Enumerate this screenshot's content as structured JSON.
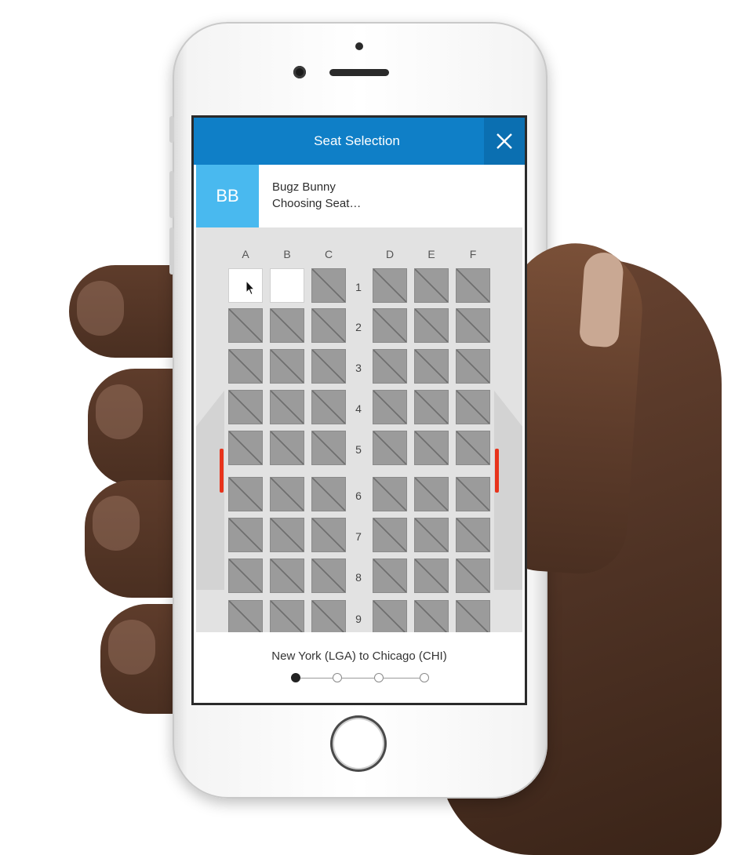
{
  "header": {
    "title": "Seat Selection"
  },
  "passenger": {
    "initials": "BB",
    "name": "Bugz Bunny",
    "status": "Choosing Seat…"
  },
  "colors": {
    "header_bg": "#0f7fc7",
    "avatar_bg": "#49b9ef",
    "exit_marker": "#e8331b"
  },
  "seatmap": {
    "columns": [
      "A",
      "B",
      "C",
      "D",
      "E",
      "F"
    ],
    "rows": [
      {
        "number": "1",
        "seats": [
          "open",
          "open",
          "taken",
          "taken",
          "taken",
          "taken"
        ]
      },
      {
        "number": "2",
        "seats": [
          "taken",
          "taken",
          "taken",
          "taken",
          "taken",
          "taken"
        ]
      },
      {
        "number": "3",
        "seats": [
          "taken",
          "taken",
          "taken",
          "taken",
          "taken",
          "taken"
        ]
      },
      {
        "number": "4",
        "seats": [
          "taken",
          "taken",
          "taken",
          "taken",
          "taken",
          "taken"
        ]
      },
      {
        "number": "5",
        "seats": [
          "taken",
          "taken",
          "taken",
          "taken",
          "taken",
          "taken"
        ]
      },
      {
        "number": "6",
        "seats": [
          "taken",
          "taken",
          "taken",
          "taken",
          "taken",
          "taken"
        ]
      },
      {
        "number": "7",
        "seats": [
          "taken",
          "taken",
          "taken",
          "taken",
          "taken",
          "taken"
        ]
      },
      {
        "number": "8",
        "seats": [
          "taken",
          "taken",
          "taken",
          "taken",
          "taken",
          "taken"
        ]
      },
      {
        "number": "9",
        "seats": [
          "taken",
          "taken",
          "taken",
          "taken",
          "taken",
          "taken"
        ]
      }
    ]
  },
  "footer": {
    "route": "New York (LGA) to Chicago (CHI)",
    "steps_total": 4,
    "steps_active": 1
  },
  "icons": {
    "close": "close-icon",
    "cursor": "pointer-cursor-icon",
    "seat_taken": "seat-unavailable-icon"
  }
}
